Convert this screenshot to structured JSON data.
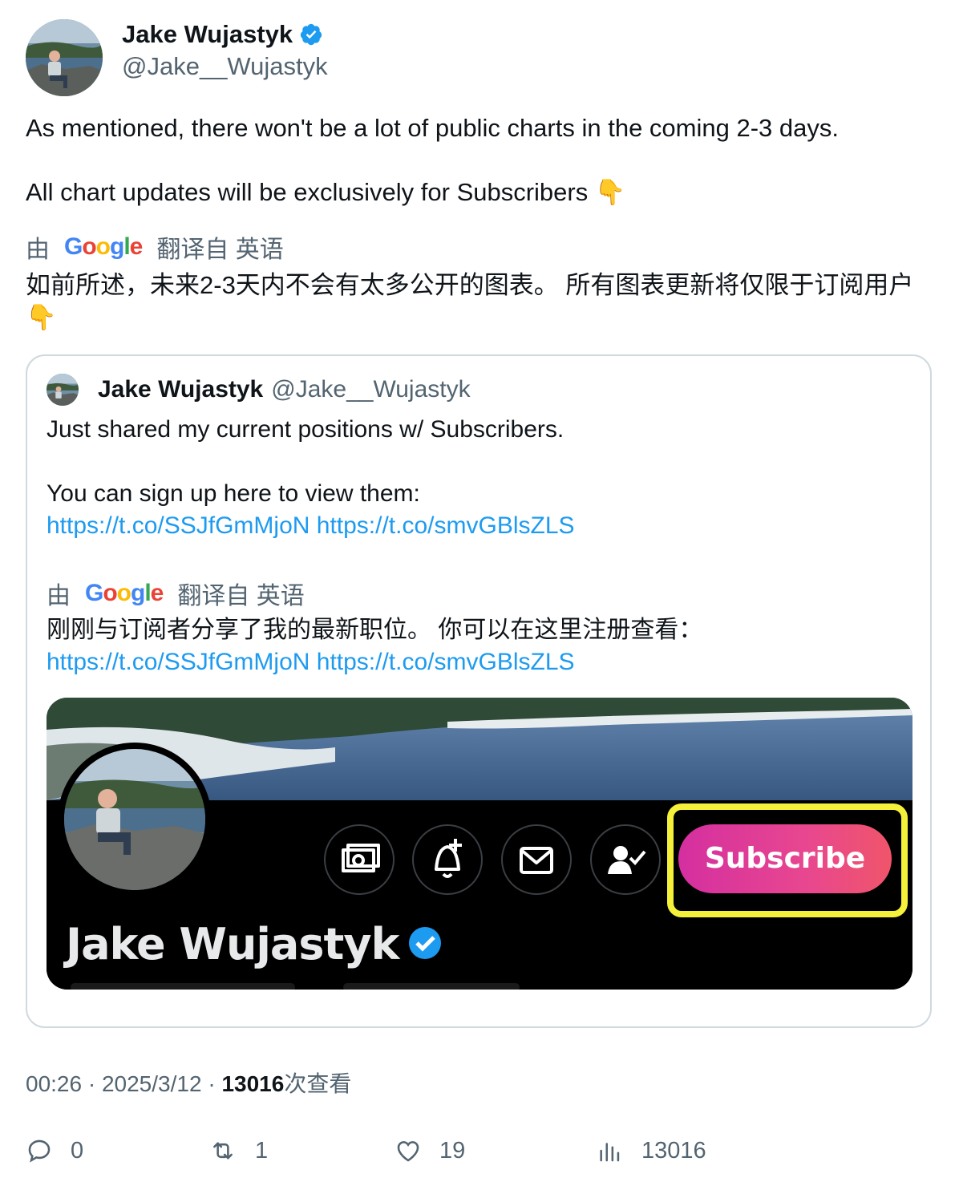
{
  "author": {
    "name": "Jake Wujastyk",
    "handle": "@Jake__Wujastyk"
  },
  "tweet": {
    "line1": "As mentioned, there won't be a lot of public charts in the coming 2-3 days.",
    "line2": "All chart updates will be exclusively for Subscribers",
    "emoji": "👇",
    "translation_prefix": "由",
    "translation_suffix": "翻译自 英语",
    "translated_text": "如前所述，未来2-3天内不会有太多公开的图表。 所有图表更新将仅限于订阅用户👇"
  },
  "quote": {
    "name": "Jake Wujastyk",
    "handle": "@Jake__Wujastyk",
    "line1": "Just shared my current positions w/ Subscribers.",
    "line2": "You can sign up here to view them:",
    "link1": "https://t.co/SSJfGmMjoN",
    "link2": "https://t.co/smvGBlsZLS",
    "translation_prefix": "由",
    "translation_suffix": "翻译自 英语",
    "translated_text": "刚刚与订阅者分享了我的最新职位。 你可以在这里注册查看：",
    "image": {
      "profile_name": "Jake Wujastyk",
      "subscribe_label": "Subscribe",
      "highlight_color": "#f5f03a"
    }
  },
  "meta": {
    "time": "00:26",
    "sep": "·",
    "date": "2025/3/12",
    "views": "13016",
    "views_label": "次查看"
  },
  "actions": {
    "replies": "0",
    "retweets": "1",
    "likes": "19",
    "views": "13016"
  },
  "google_logo": [
    "G",
    "o",
    "o",
    "g",
    "l",
    "e"
  ],
  "colors": {
    "link": "#1d9bf0",
    "secondary_text": "#536471",
    "verified": "#1d9bf0"
  }
}
